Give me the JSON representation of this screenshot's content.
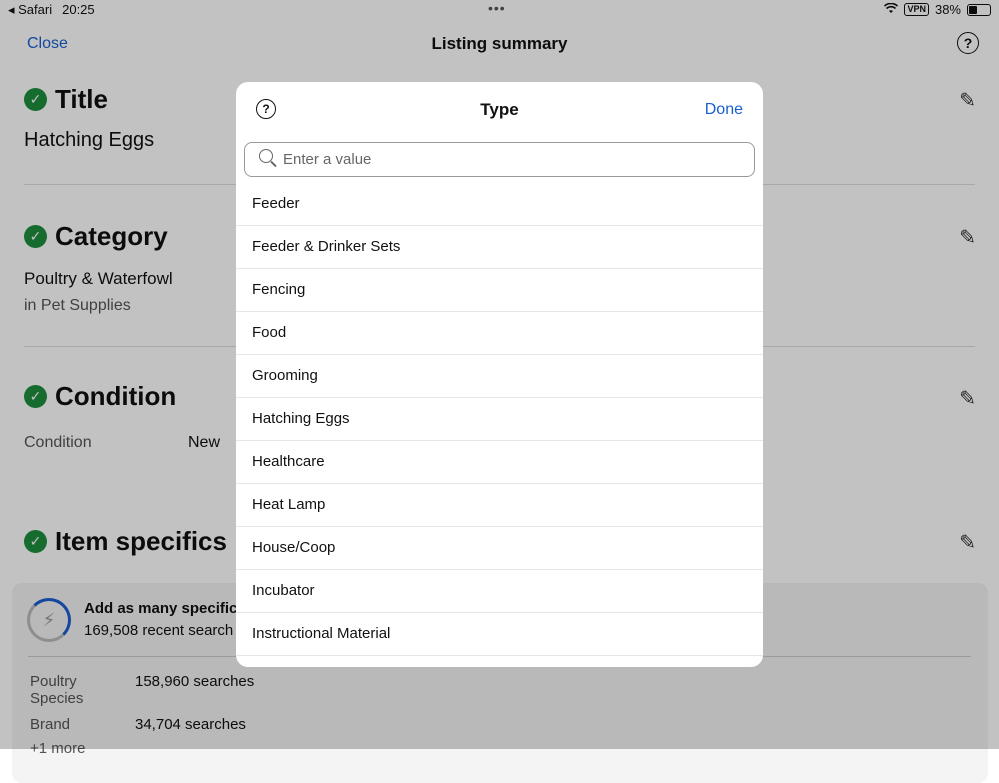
{
  "status": {
    "app": "◂ Safari",
    "time": "20:25",
    "dots": "•••",
    "vpn": "VPN",
    "battery": "38%"
  },
  "nav": {
    "close": "Close",
    "title": "Listing summary",
    "help": "?"
  },
  "sections": {
    "title": {
      "heading": "Title",
      "value": "Hatching Eggs"
    },
    "category": {
      "heading": "Category",
      "value": "Poultry & Waterfowl",
      "sub": "in Pet Supplies"
    },
    "condition": {
      "heading": "Condition",
      "label": "Condition",
      "value": "New"
    },
    "specifics": {
      "heading": "Item specifics"
    }
  },
  "card": {
    "heading": "Add as many specific",
    "sub": "169,508 recent search",
    "rows": [
      {
        "label": "Poultry Species",
        "value": "158,960 searches"
      },
      {
        "label": "Brand",
        "value": "34,704 searches"
      }
    ],
    "more": "+1 more"
  },
  "modal": {
    "help": "?",
    "title": "Type",
    "done": "Done",
    "search_placeholder": "Enter a value",
    "items": [
      "Feeder",
      "Feeder & Drinker Sets",
      "Fencing",
      "Food",
      "Grooming",
      "Hatching Eggs",
      "Healthcare",
      "Heat Lamp",
      "House/Coop",
      "Incubator",
      "Instructional Material"
    ]
  }
}
